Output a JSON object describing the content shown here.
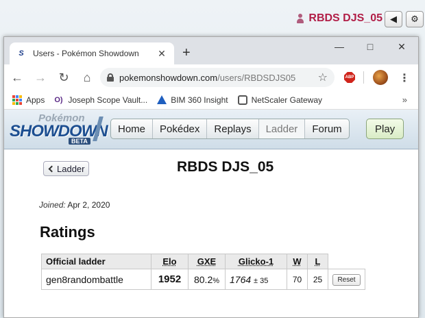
{
  "background": {
    "username": "RBDS DJS_05",
    "sound_icon": "speaker-icon",
    "settings_icon": "gear-icon"
  },
  "browser": {
    "tab_title": "Users - Pokémon Showdown",
    "url_host": "pokemonshowdown.com",
    "url_path": "/users/RBDSDJS05",
    "extension": "ABP",
    "bookmarks": [
      {
        "label": "Apps"
      },
      {
        "label": "Joseph Scope Vault..."
      },
      {
        "label": "BIM 360 Insight"
      },
      {
        "label": "NetScaler Gateway"
      }
    ],
    "colors": {
      "tabbar": "#dee1e6",
      "abp": "#d0241b"
    }
  },
  "showdown": {
    "logo": {
      "top": "Pokémon",
      "main": "SHOWDOWN",
      "badge": "BETA"
    },
    "nav": [
      "Home",
      "Pokédex",
      "Replays",
      "Ladder",
      "Forum"
    ],
    "current_nav": "Ladder",
    "play_label": "Play"
  },
  "profile": {
    "back_label": "Ladder",
    "username": "RBDS DJS_05",
    "joined_label": "Joined:",
    "joined_value": "Apr 2, 2020",
    "ratings_heading": "Ratings",
    "table": {
      "headers": [
        "Official ladder",
        "Elo",
        "GXE",
        "Glicko-1",
        "W",
        "L"
      ],
      "rows": [
        {
          "format": "gen8randombattle",
          "elo": "1952",
          "gxe_value": "80.2",
          "gxe_unit": "%",
          "glicko": "1764",
          "glicko_dev": "± 35",
          "w": "70",
          "l": "25",
          "reset_label": "Reset"
        }
      ]
    }
  }
}
